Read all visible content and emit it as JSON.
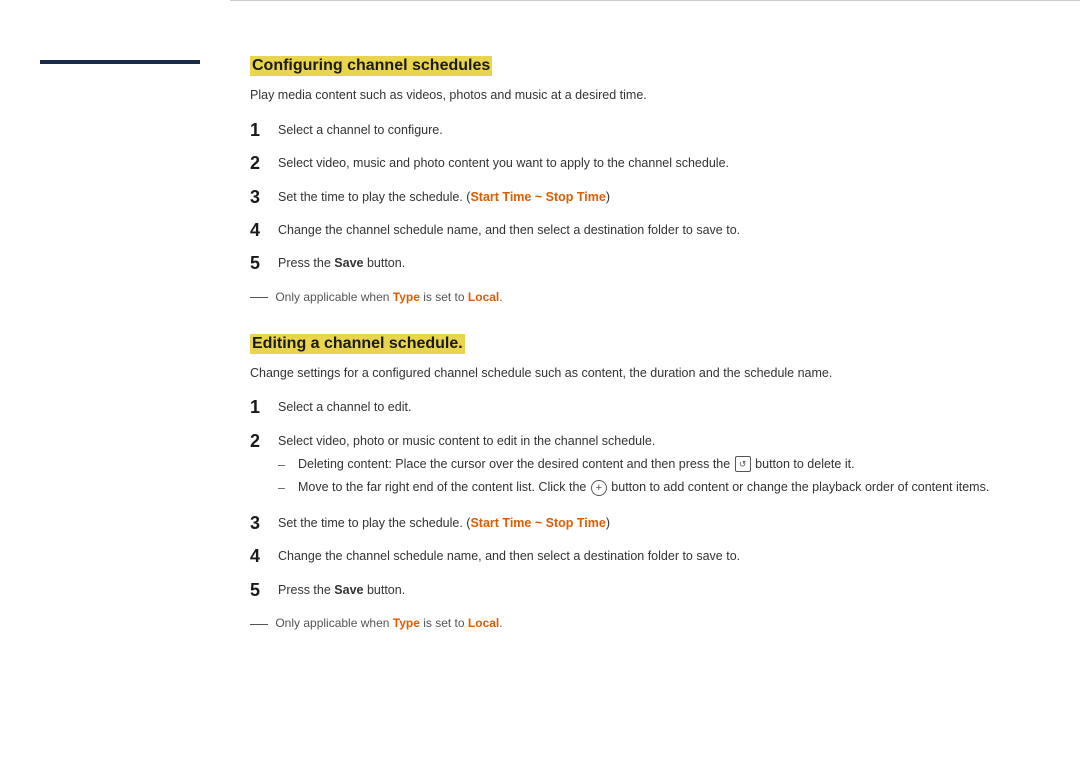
{
  "sidebar": {
    "bar_label": "sidebar-bar"
  },
  "section1": {
    "title": "Configuring channel schedules",
    "intro": "Play media content such as videos, photos and music at a desired time.",
    "steps": [
      {
        "number": "1",
        "text": "Select a channel to configure."
      },
      {
        "number": "2",
        "text": "Select video, music and photo content you want to apply to the channel schedule."
      },
      {
        "number": "3",
        "text_before": "Set the time to play the schedule. (",
        "highlight": "Start Time ~ Stop Time",
        "text_after": ")"
      },
      {
        "number": "4",
        "text": "Change the channel schedule name, and then select a destination folder to save to."
      },
      {
        "number": "5",
        "text_before": "Press the ",
        "bold": "Save",
        "text_after": " button."
      }
    ],
    "note": "Only applicable when ",
    "note_type": "Type",
    "note_mid": " is set to ",
    "note_local": "Local",
    "note_end": "."
  },
  "section2": {
    "title": "Editing a channel schedule.",
    "intro": "Change settings for a configured channel schedule such as content, the duration and the schedule name.",
    "steps": [
      {
        "number": "1",
        "text": "Select a channel to edit."
      },
      {
        "number": "2",
        "text": "Select video, photo or music content to edit in the channel schedule."
      },
      {
        "number": "3",
        "text_before": "Set the time to play the schedule. (",
        "highlight": "Start Time ~ Stop Time",
        "text_after": ")"
      },
      {
        "number": "4",
        "text": "Change the channel schedule name, and then select a destination folder to save to."
      },
      {
        "number": "5",
        "text_before": "Press the ",
        "bold": "Save",
        "text_after": " button."
      }
    ],
    "sub_bullets": [
      {
        "text_before": "Deleting content: Place the cursor over the desired content and then press the ",
        "icon": "del",
        "text_after": " button to delete it."
      },
      {
        "text_before": "Move to the far right end of the content list. Click the ",
        "icon": "plus",
        "text_after": " button to add content or change the playback order of content items."
      }
    ],
    "note": "Only applicable when ",
    "note_type": "Type",
    "note_mid": " is set to ",
    "note_local": "Local",
    "note_end": "."
  }
}
